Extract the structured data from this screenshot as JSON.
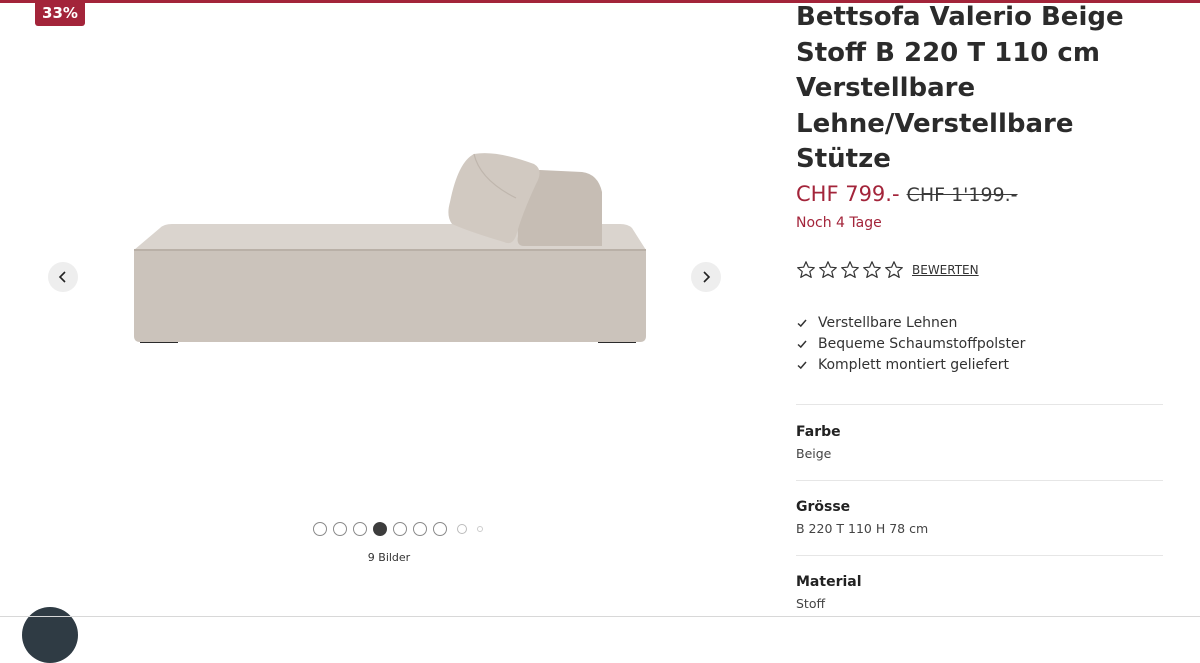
{
  "badge": {
    "discount": "33%"
  },
  "gallery": {
    "image_alt": "Bettsofa Valerio Beige",
    "image_count": "9 Bilder",
    "dots_total": 9,
    "active_index": 3,
    "prev_icon": "chevron-left-icon",
    "next_icon": "chevron-right-icon"
  },
  "product": {
    "title": "Bettsofa Valerio Beige Stoff B 220 T 110 cm Verstellbare Lehne/Verstellbare Stütze",
    "price": "CHF 799.-",
    "old_price": "CHF 1'199.-",
    "sale_note": "Noch 4 Tage",
    "rating_stars": 0,
    "rating_max": 5,
    "rate_label": "BEWERTEN",
    "features": [
      "Verstellbare Lehnen",
      "Bequeme Schaumstoffpolster",
      "Komplett montiert geliefert"
    ],
    "attributes": [
      {
        "label": "Farbe",
        "value": "Beige"
      },
      {
        "label": "Grösse",
        "value": "B 220 T 110 H 78 cm"
      },
      {
        "label": "Material",
        "value": "Stoff"
      }
    ]
  },
  "colors": {
    "accent": "#a3243a",
    "sofa": "#cfc6be",
    "text": "#2b2b2b"
  }
}
